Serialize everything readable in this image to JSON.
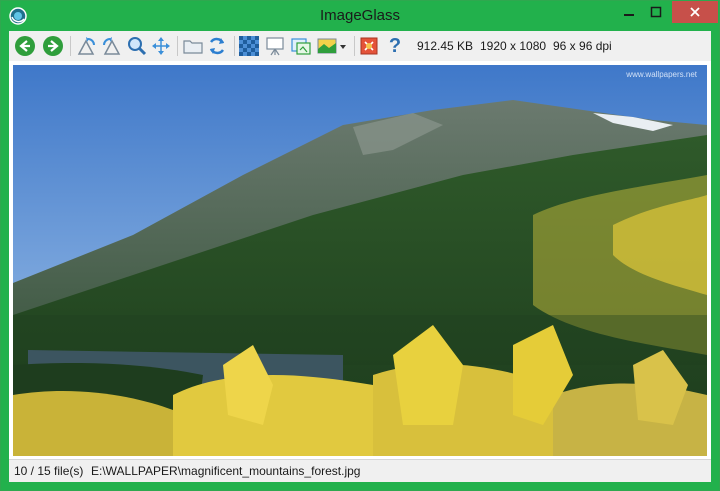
{
  "window": {
    "title": "ImageGlass",
    "titlebar_color": "#22b14c",
    "close_color": "#c7504a"
  },
  "toolbar": {
    "buttons": [
      {
        "name": "back",
        "icon": "green-back-arrow-icon"
      },
      {
        "name": "forward",
        "icon": "green-forward-arrow-icon"
      },
      {
        "name": "rotate-left",
        "icon": "rotate-left-icon"
      },
      {
        "name": "rotate-right",
        "icon": "rotate-right-icon"
      },
      {
        "name": "zoom",
        "icon": "magnifier-icon"
      },
      {
        "name": "move",
        "icon": "move-arrows-icon"
      },
      {
        "name": "open",
        "icon": "folder-icon"
      },
      {
        "name": "refresh",
        "icon": "refresh-icon"
      },
      {
        "name": "checkerboard",
        "icon": "checkerboard-icon"
      },
      {
        "name": "slideshow",
        "icon": "slideshow-icon"
      },
      {
        "name": "thumbnails",
        "icon": "thumbnail-icon"
      },
      {
        "name": "theme",
        "icon": "theme-icon"
      },
      {
        "name": "settings",
        "icon": "settings-icon"
      },
      {
        "name": "help",
        "icon": "help-icon"
      }
    ],
    "file_size": "912.45 KB",
    "dimensions": "1920 x 1080",
    "dpi": "96 x 96 dpi"
  },
  "image": {
    "watermark": "www.wallpapers.net"
  },
  "status": {
    "file_count": "10 / 15 file(s)",
    "file_path": "E:\\WALLPAPER\\magnificent_mountains_forest.jpg"
  }
}
